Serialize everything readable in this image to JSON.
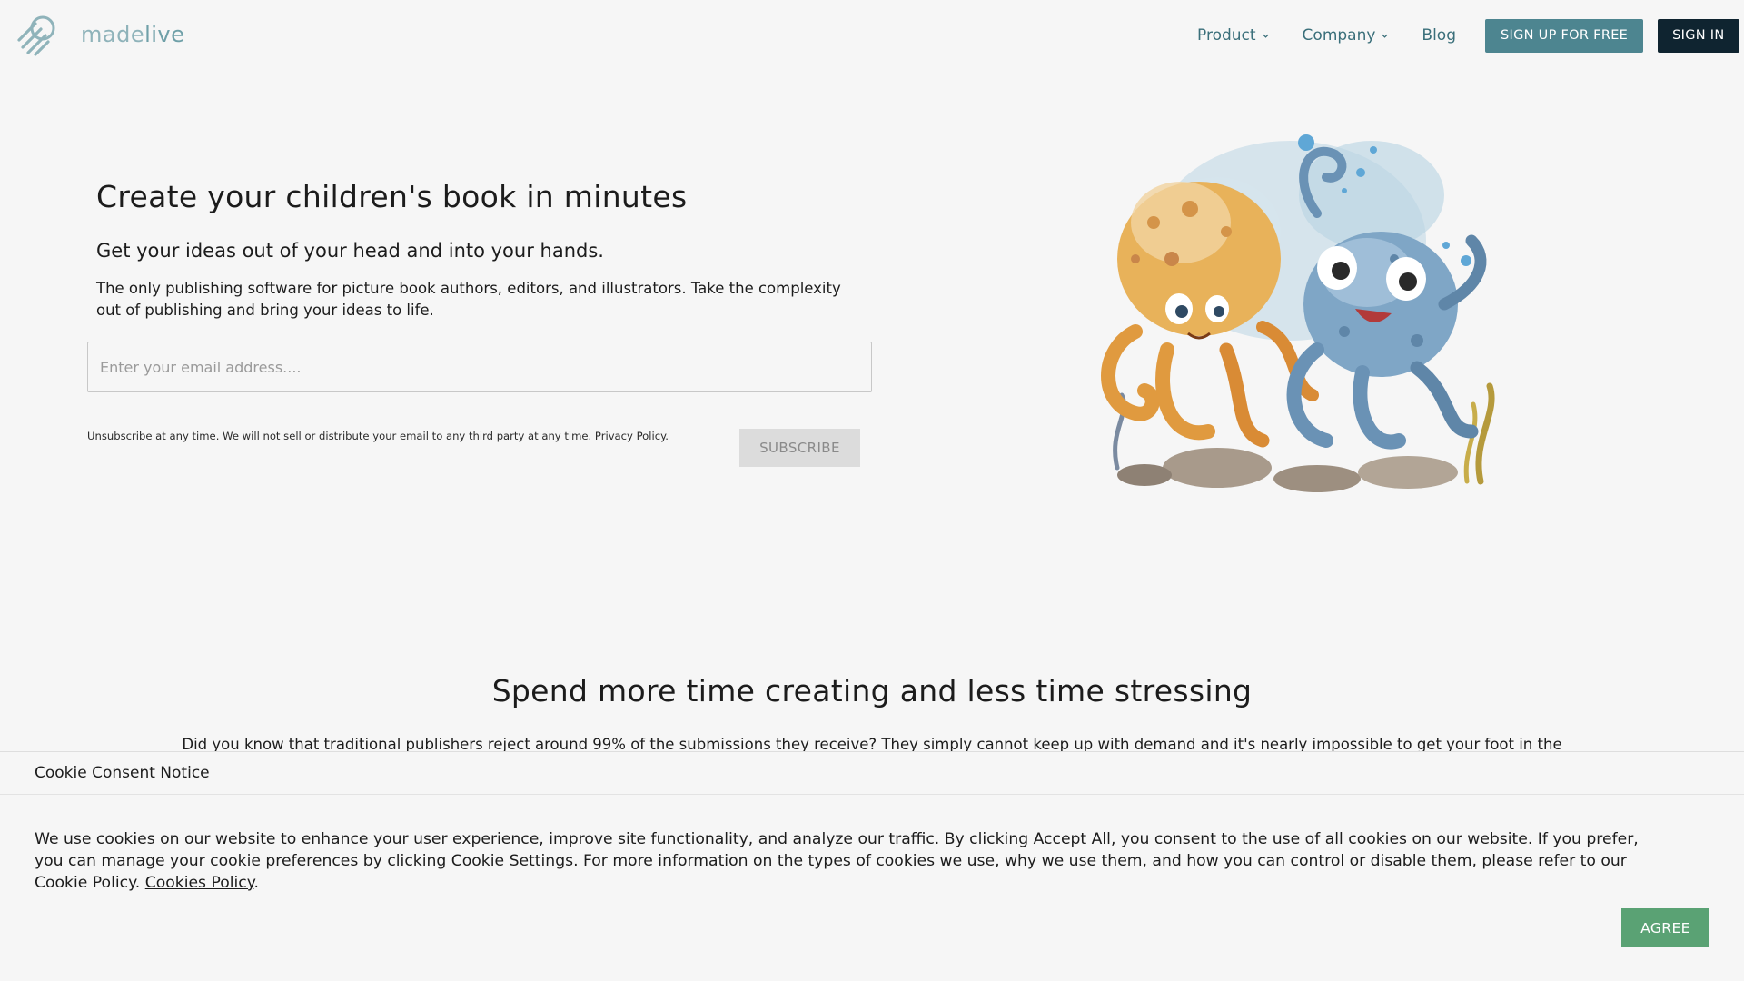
{
  "brand": {
    "name_part1": "made",
    "name_part2": "live",
    "accent_color": "#4d8590",
    "dark_color": "#0f2430"
  },
  "nav": {
    "items": [
      {
        "label": "Product",
        "has_dropdown": true
      },
      {
        "label": "Company",
        "has_dropdown": true
      },
      {
        "label": "Blog",
        "has_dropdown": false
      }
    ],
    "signup_label": "SIGN UP FOR FREE",
    "signin_label": "SIGN IN"
  },
  "hero": {
    "title": "Create your children's book in minutes",
    "subtitle": "Get your ideas out of your head and into your hands.",
    "description": "The only publishing software for picture book authors, editors, and illustrators. Take the complexity out of publishing and bring your ideas to life.",
    "email_placeholder": "Enter your email address....",
    "email_value": "",
    "disclaimer_text": "Unsubscribe at any time. We will not sell or distribute your email to any third party at any time.",
    "privacy_link": "Privacy Policy",
    "disclaimer_end": ".",
    "subscribe_label": "SUBSCRIBE",
    "illustration": "two-cartoon-octopuses-watercolor"
  },
  "section2": {
    "title": "Spend more time creating and less time stressing",
    "text": "Did you know that traditional publishers reject around 99% of the submissions they receive? They simply cannot keep up with demand and it's nearly impossible to get your foot in the"
  },
  "cookie": {
    "title": "Cookie Consent Notice",
    "body": "We use cookies on our website to enhance your user experience, improve site functionality, and analyze our traffic. By clicking Accept All, you consent to the use of all cookies on our website. If you prefer, you can manage your cookie preferences by clicking Cookie Settings. For more information on the types of cookies we use, why we use them, and how you can control or disable them, please refer to our Cookie Policy.",
    "link": "Cookies Policy",
    "link_end": ".",
    "agree_label": "AGREE",
    "agree_color": "#5aa274"
  }
}
